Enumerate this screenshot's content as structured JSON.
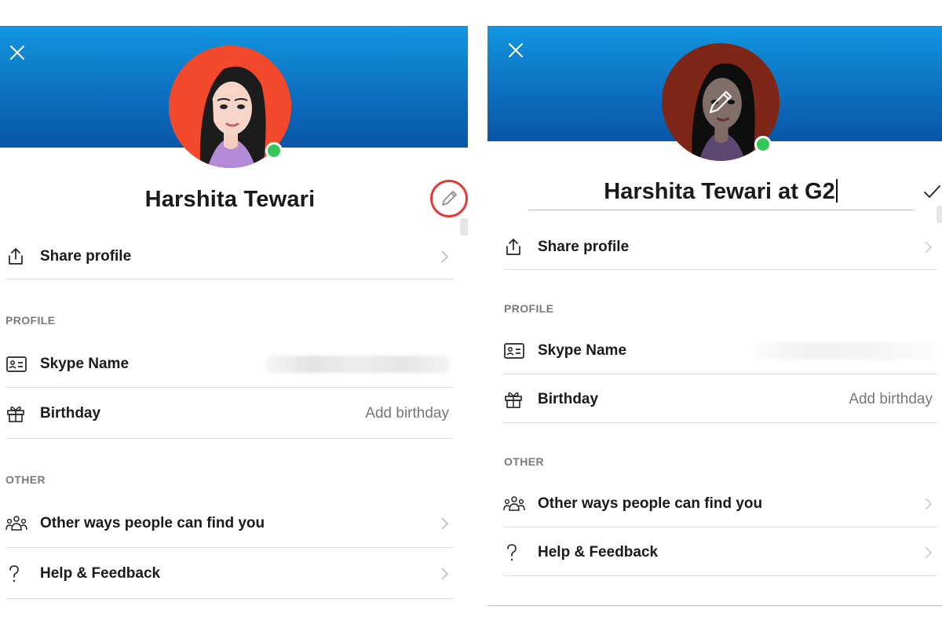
{
  "profile": {
    "display_name": "Harshita Tewari",
    "edited_display_name": "Harshita Tewari at G2",
    "presence": "online"
  },
  "colors": {
    "header_top": "#1296e0",
    "header_bottom": "#0a55a8",
    "avatar_background": "#f2492c",
    "presence_green": "#35c759",
    "highlight_ring": "#e53935"
  },
  "rows": {
    "share_profile": "Share profile",
    "skype_name": "Skype Name",
    "birthday": "Birthday",
    "birthday_value": "Add birthday",
    "other_ways": "Other ways people can find you",
    "help_feedback": "Help & Feedback"
  },
  "sections": {
    "profile": "PROFILE",
    "other": "OTHER"
  },
  "icons": {
    "close": "close-icon",
    "edit": "pencil-icon",
    "confirm": "checkmark-icon",
    "share": "share-icon",
    "id_card": "id-card-icon",
    "gift": "gift-icon",
    "people": "people-group-icon",
    "help": "question-mark-icon",
    "chevron": "chevron-right-icon"
  }
}
